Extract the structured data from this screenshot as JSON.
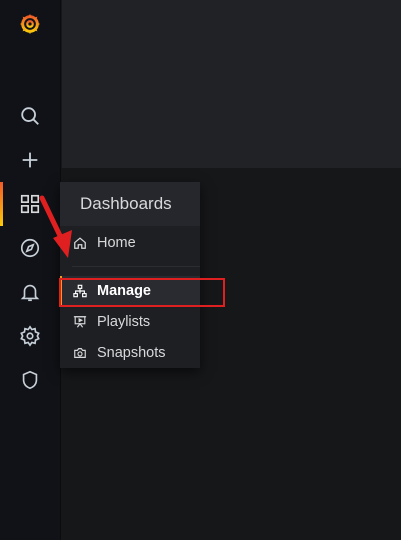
{
  "menu": {
    "title": "Dashboards",
    "items": [
      {
        "label": "Home",
        "icon": "home-icon"
      },
      {
        "label": "Manage",
        "icon": "sitemap-icon"
      },
      {
        "label": "Playlists",
        "icon": "presentation-play-icon"
      },
      {
        "label": "Snapshots",
        "icon": "camera-icon"
      }
    ],
    "active_item": "Manage"
  },
  "sidebar": {
    "icons": [
      "grafana-logo",
      "search-icon",
      "plus-icon",
      "apps-icon",
      "compass-icon",
      "bell-icon",
      "cog-icon",
      "shield-icon"
    ],
    "active": "apps-icon"
  },
  "colors": {
    "accent_orange": "#f59b17",
    "annotation_red": "#e02020"
  }
}
